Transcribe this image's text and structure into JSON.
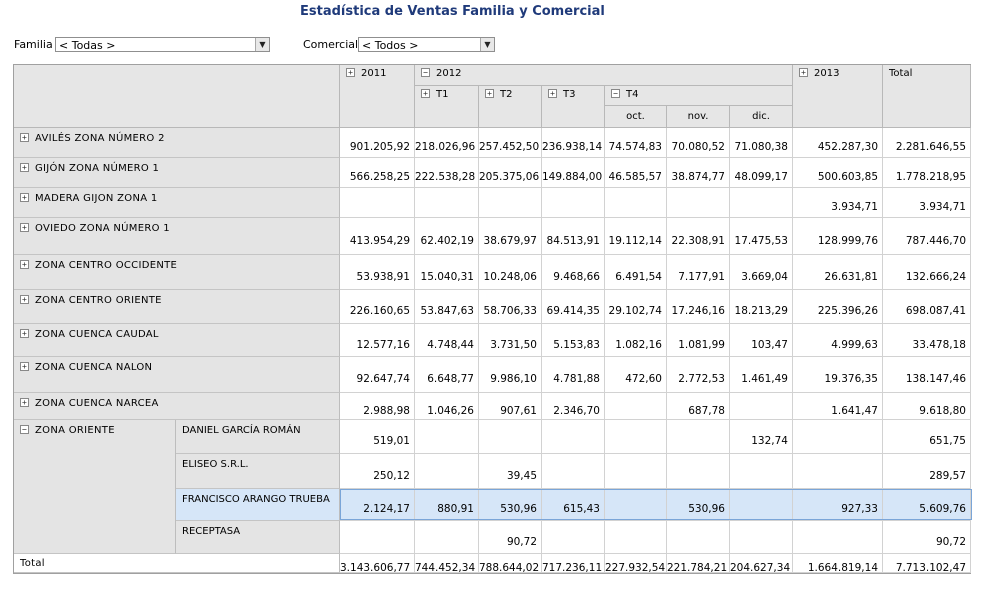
{
  "title": "Estadística de Ventas Familia y Comercial",
  "filters": {
    "familia": {
      "label": "Familia",
      "value": "< Todas >"
    },
    "comercial": {
      "label": "Comercial",
      "value": "< Todos >"
    }
  },
  "headers": {
    "y2011": "2011",
    "y2012": "2012",
    "y2013": "2013",
    "total": "Total",
    "t1": "T1",
    "t2": "T2",
    "t3": "T3",
    "t4": "T4",
    "oct": "oct.",
    "nov": "nov.",
    "dic": "dic."
  },
  "rows": [
    {
      "label": "AVILÉS ZONA NÚMERO 2",
      "values": [
        "901.205,92",
        "218.026,96",
        "257.452,50",
        "236.938,14",
        "74.574,83",
        "70.080,52",
        "71.080,38",
        "452.287,30",
        "2.281.646,55"
      ]
    },
    {
      "label": "GIJÓN ZONA NÚMERO 1",
      "values": [
        "566.258,25",
        "222.538,28",
        "205.375,06",
        "149.884,00",
        "46.585,57",
        "38.874,77",
        "48.099,17",
        "500.603,85",
        "1.778.218,95"
      ]
    },
    {
      "label": "MADERA GIJON ZONA 1",
      "values": [
        "",
        "",
        "",
        "",
        "",
        "",
        "",
        "3.934,71",
        "3.934,71"
      ]
    },
    {
      "label": "OVIEDO ZONA NÚMERO 1",
      "values": [
        "413.954,29",
        "62.402,19",
        "38.679,97",
        "84.513,91",
        "19.112,14",
        "22.308,91",
        "17.475,53",
        "128.999,76",
        "787.446,70"
      ]
    },
    {
      "label": "ZONA CENTRO OCCIDENTE",
      "values": [
        "53.938,91",
        "15.040,31",
        "10.248,06",
        "9.468,66",
        "6.491,54",
        "7.177,91",
        "3.669,04",
        "26.631,81",
        "132.666,24"
      ]
    },
    {
      "label": "ZONA CENTRO ORIENTE",
      "values": [
        "226.160,65",
        "53.847,63",
        "58.706,33",
        "69.414,35",
        "29.102,74",
        "17.246,16",
        "18.213,29",
        "225.396,26",
        "698.087,41"
      ]
    },
    {
      "label": "ZONA CUENCA CAUDAL",
      "values": [
        "12.577,16",
        "4.748,44",
        "3.731,50",
        "5.153,83",
        "1.082,16",
        "1.081,99",
        "103,47",
        "4.999,63",
        "33.478,18"
      ]
    },
    {
      "label": "ZONA CUENCA NALON",
      "values": [
        "92.647,74",
        "6.648,77",
        "9.986,10",
        "4.781,88",
        "472,60",
        "2.772,53",
        "1.461,49",
        "19.376,35",
        "138.147,46"
      ]
    },
    {
      "label": "ZONA CUENCA NARCEA",
      "values": [
        "2.988,98",
        "1.046,26",
        "907,61",
        "2.346,70",
        "",
        "687,78",
        "",
        "1.641,47",
        "9.618,80"
      ]
    }
  ],
  "oriente": {
    "label": "ZONA ORIENTE",
    "subrows": [
      {
        "label": "DANIEL GARCÍA ROMÁN",
        "values": [
          "519,01",
          "",
          "",
          "",
          "",
          "",
          "132,74",
          "",
          "651,75"
        ]
      },
      {
        "label": "ELISEO S.R.L.",
        "values": [
          "250,12",
          "",
          "39,45",
          "",
          "",
          "",
          "",
          "",
          "289,57"
        ]
      },
      {
        "label": "FRANCISCO ARANGO TRUEBA",
        "values": [
          "2.124,17",
          "880,91",
          "530,96",
          "615,43",
          "",
          "530,96",
          "",
          "927,33",
          "5.609,76"
        ]
      },
      {
        "label": "RECEPTASA",
        "values": [
          "",
          "",
          "90,72",
          "",
          "",
          "",
          "",
          "",
          "90,72"
        ]
      }
    ]
  },
  "totals": {
    "label": "Total",
    "values": [
      "3.143.606,77",
      "744.452,34",
      "788.644,02",
      "717.236,11",
      "227.932,54",
      "221.784,21",
      "204.627,34",
      "1.664.819,14",
      "7.713.102,47"
    ]
  },
  "expander": {
    "plus": "+",
    "minus": "−"
  },
  "colors": {
    "title": "#1f3a7a",
    "header_bg": "#e6e6e6",
    "highlight": "#d6e6f8"
  }
}
